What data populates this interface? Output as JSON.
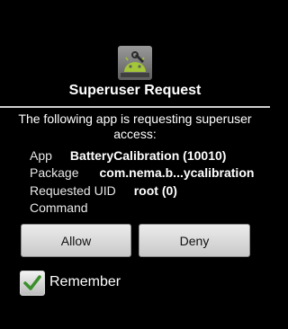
{
  "dialog": {
    "title": "Superuser Request",
    "message": "The following app is requesting superuser access:",
    "icon": "android-robot-repair-icon"
  },
  "details": {
    "app_key": "App",
    "app_value": "BatteryCalibration (10010)",
    "package_key": "Package",
    "package_value": "com.nema.b...ycalibration",
    "uid_key": "Requested UID",
    "uid_value": "root (0)",
    "command_key": "Command"
  },
  "buttons": {
    "allow_label": "Allow",
    "deny_label": "Deny"
  },
  "remember": {
    "label": "Remember",
    "checked": true
  },
  "colors": {
    "background": "#000000",
    "check_green": "#3a8f2a",
    "robot_green": "#a4c639"
  }
}
